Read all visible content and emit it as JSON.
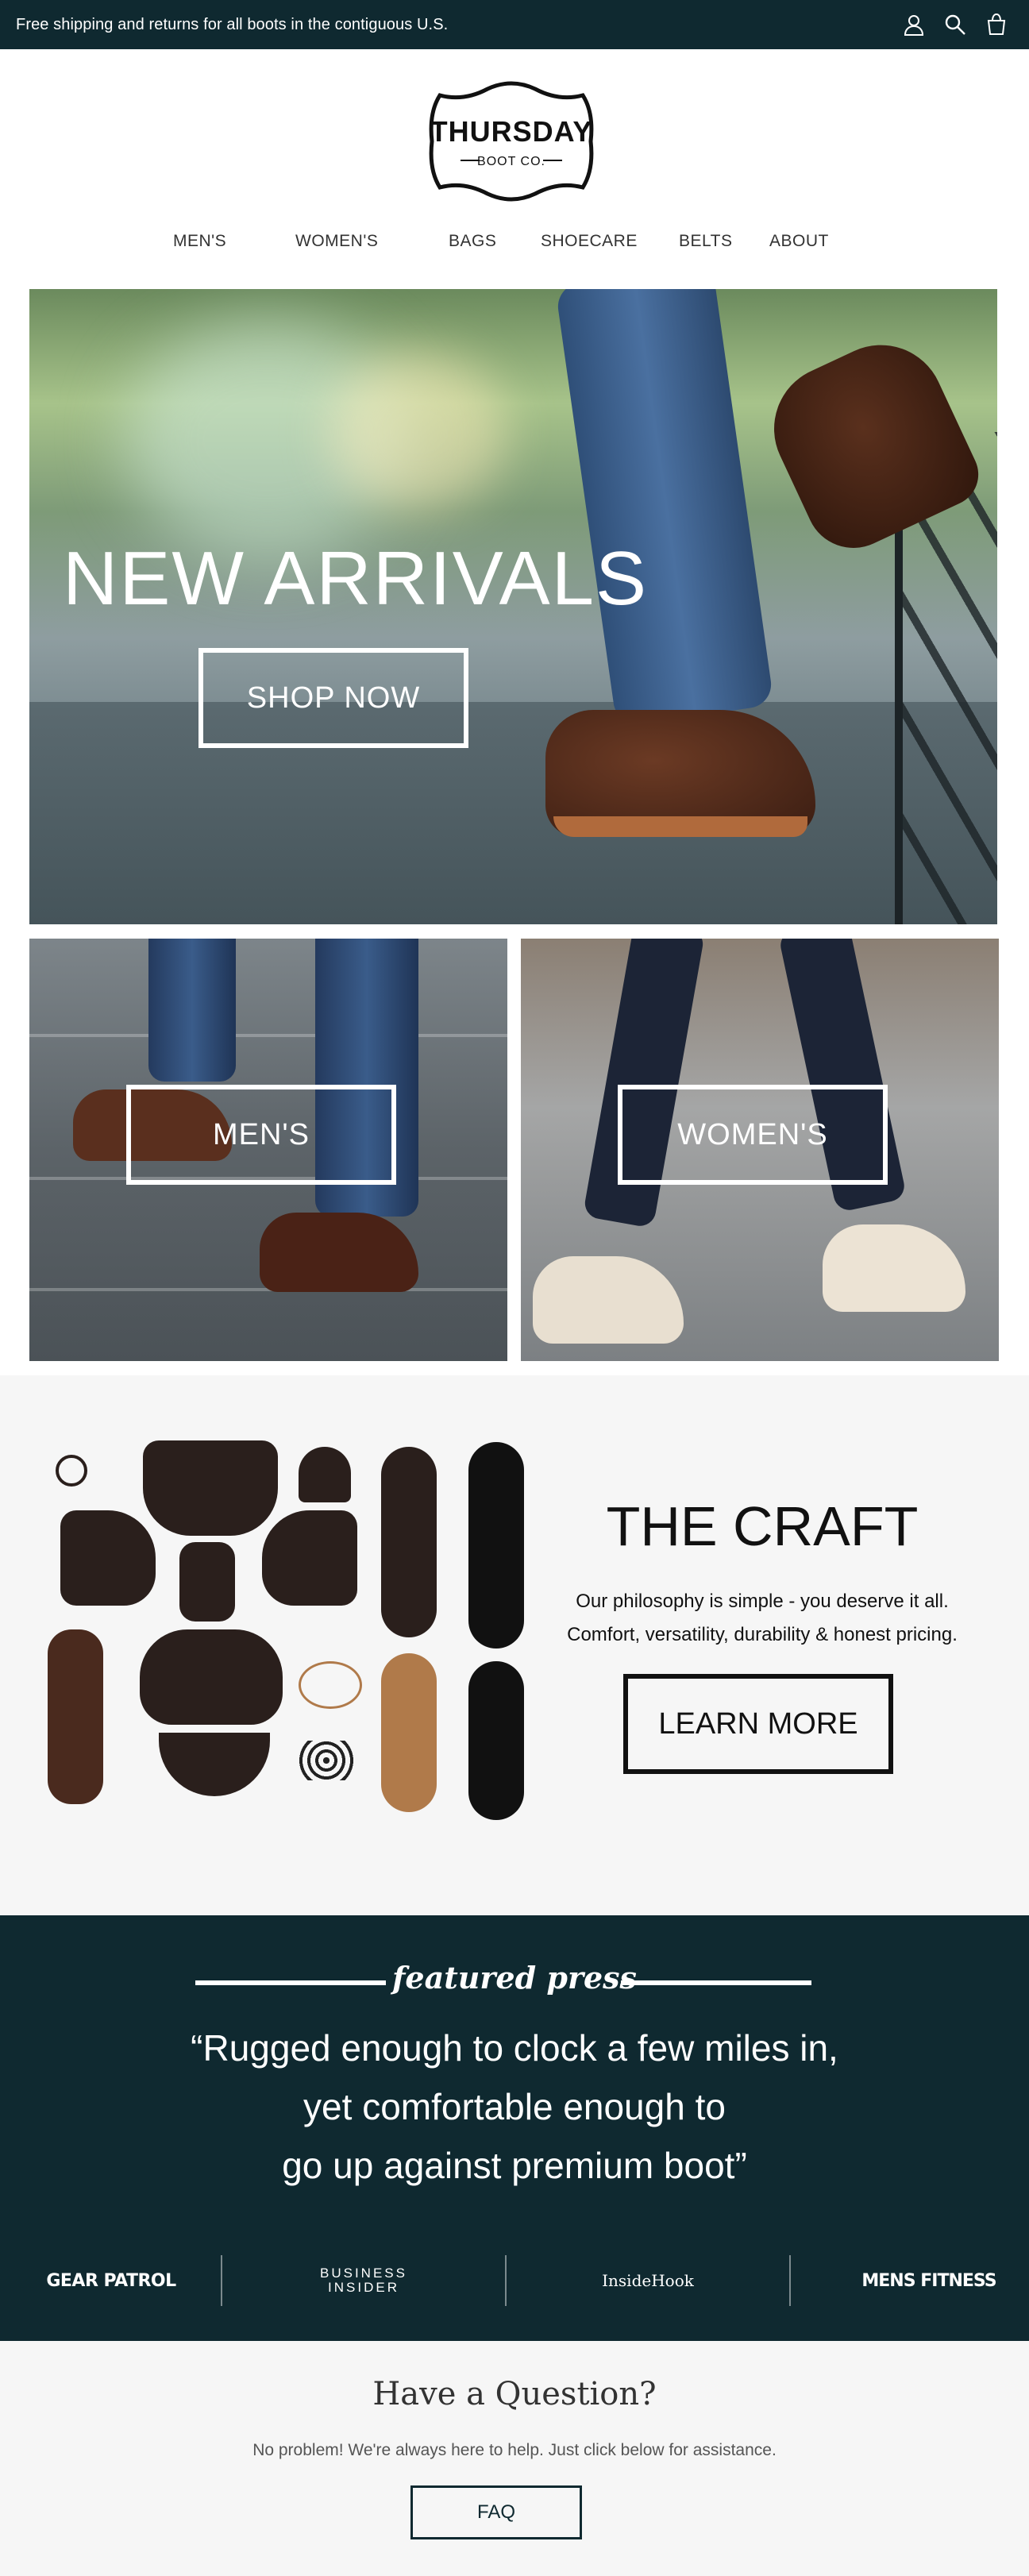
{
  "announcement": {
    "text": "Free shipping and returns for all boots in the contiguous U.S."
  },
  "header_icons": [
    "account-icon",
    "search-icon",
    "cart-icon"
  ],
  "brand": {
    "name_line1": "THURSDAY",
    "name_line2": "BOOT CO."
  },
  "nav": [
    "MEN'S",
    "WOMEN'S",
    "BAGS",
    "SHOECARE",
    "BELTS",
    "ABOUT"
  ],
  "hero": {
    "title": "NEW ARRIVALS",
    "cta": "SHOP NOW"
  },
  "categories": {
    "men": "MEN'S",
    "women": "WOMEN'S"
  },
  "craft": {
    "title": "THE CRAFT",
    "line1": "Our philosophy is simple - you deserve it all.",
    "line2": "Comfort, versatility, durability & honest pricing.",
    "cta": "LEARN MORE"
  },
  "press": {
    "label": "featured press",
    "quote_line1": "“Rugged enough to clock a few miles in,",
    "quote_line2": "yet comfortable enough to",
    "quote_line3": "go up against premium boot”",
    "logos": [
      "GEAR PATROL",
      "BUSINESS INSIDER",
      "InsideHook",
      "MENS FITNESS"
    ]
  },
  "faq": {
    "title": "Have a Question?",
    "text": "No problem! We're always here to help. Just click below for assistance.",
    "cta": "FAQ"
  },
  "colors": {
    "dark_teal": "#0f2930",
    "light_bg": "#f6f6f6"
  }
}
